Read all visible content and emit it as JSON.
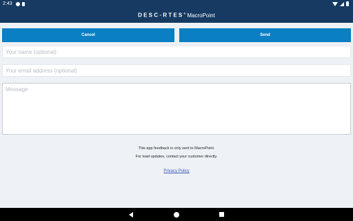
{
  "status_bar": {
    "time": "2:43",
    "icons": [
      "g-icon",
      "doc-icon",
      "wifi-icon",
      "signal-icon",
      "battery-icon"
    ]
  },
  "app_bar": {
    "brand": "DESC",
    "brand_rest": "RTES",
    "brand_mark": "®",
    "product": "MacroPoint"
  },
  "actions": {
    "cancel_label": "Cancel",
    "send_label": "Send"
  },
  "form": {
    "name_placeholder": "Your name (optional)",
    "email_placeholder": "Your email address (optional)",
    "message_placeholder": "Message"
  },
  "footer": {
    "note_line1": "This app feedback is only sent to MacroPoint.",
    "note_line2": "For load updates, contact your customer directly.",
    "privacy_link": "Privacy Policy"
  },
  "colors": {
    "app_bar": "#163a61",
    "button": "#0a7fc4",
    "background": "#eef1f5",
    "link": "#3a58b5"
  }
}
